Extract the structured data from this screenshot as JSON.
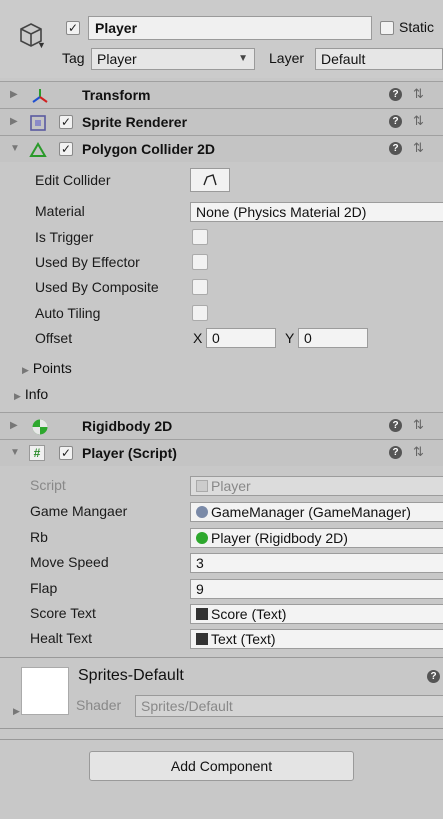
{
  "header": {
    "name": "Player",
    "static_label": "Static",
    "tag_label": "Tag",
    "tag_value": "Player",
    "layer_label": "Layer",
    "layer_value": "Default"
  },
  "components": {
    "transform": "Transform",
    "sprite_renderer": "Sprite Renderer",
    "polygon_collider": "Polygon Collider 2D",
    "rigidbody": "Rigidbody 2D",
    "player_script": "Player (Script)"
  },
  "collider": {
    "edit_collider": "Edit Collider",
    "material_label": "Material",
    "material_value": "None (Physics Material 2D)",
    "is_trigger": "Is Trigger",
    "used_by_effector": "Used By Effector",
    "used_by_composite": "Used By Composite",
    "auto_tiling": "Auto Tiling",
    "offset_label": "Offset",
    "offset_x_label": "X",
    "offset_x": "0",
    "offset_y_label": "Y",
    "offset_y": "0",
    "points": "Points",
    "info": "Info"
  },
  "script": {
    "script_label": "Script",
    "script_value": "Player",
    "game_manager_label": "Game Mangaer",
    "game_manager_value": "GameManager (GameManager)",
    "rb_label": "Rb",
    "rb_value": "Player (Rigidbody 2D)",
    "move_speed_label": "Move Speed",
    "move_speed_value": "3",
    "flap_label": "Flap",
    "flap_value": "9",
    "score_text_label": "Score Text",
    "score_text_value": "Score (Text)",
    "healt_text_label": "Healt Text",
    "healt_text_value": "Text (Text)"
  },
  "material": {
    "name": "Sprites-Default",
    "shader_label": "Shader",
    "shader_value": "Sprites/Default"
  },
  "add_component": "Add Component"
}
